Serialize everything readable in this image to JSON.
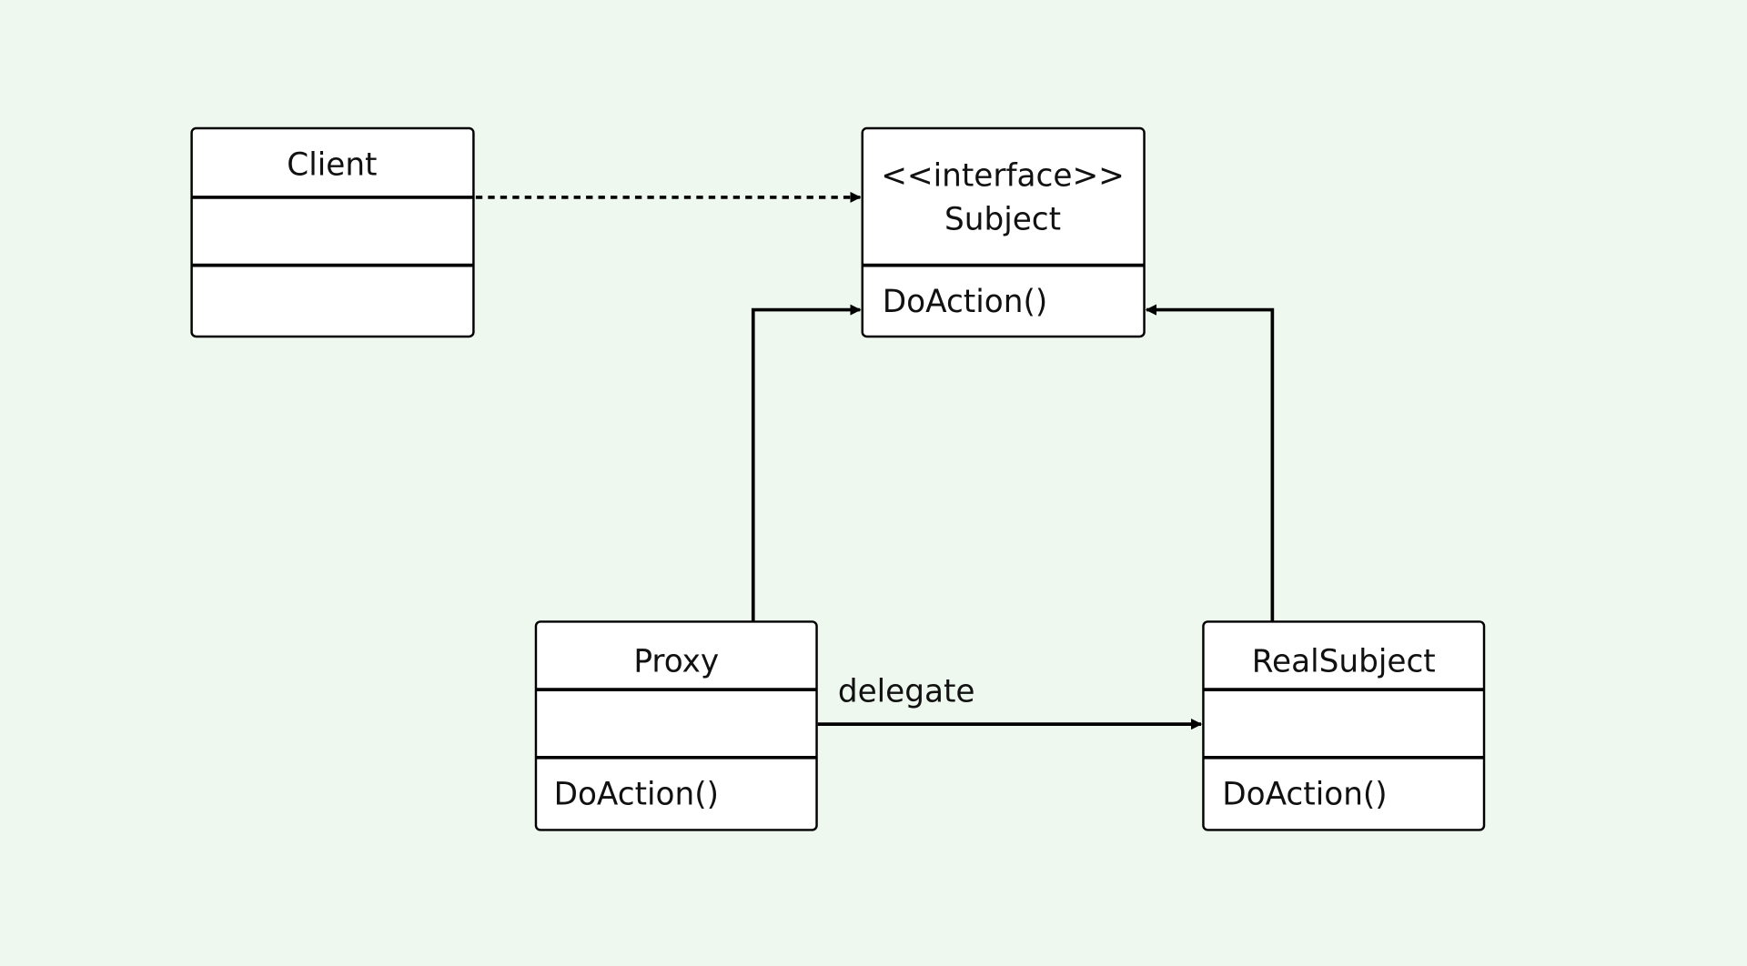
{
  "diagram": {
    "background": "#eef8ef",
    "classes": {
      "client": {
        "name": "Client"
      },
      "subject": {
        "stereotype": "<<interface>>",
        "name": "Subject",
        "method": "DoAction()"
      },
      "proxy": {
        "name": "Proxy",
        "method": "DoAction()"
      },
      "real_subject": {
        "name": "RealSubject",
        "method": "DoAction()"
      }
    },
    "relations": {
      "client_to_subject": {
        "type": "dependency"
      },
      "proxy_to_subject": {
        "type": "realization"
      },
      "real_subject_to_subject": {
        "type": "realization"
      },
      "proxy_to_real_subject": {
        "type": "association",
        "label": "delegate"
      }
    }
  }
}
